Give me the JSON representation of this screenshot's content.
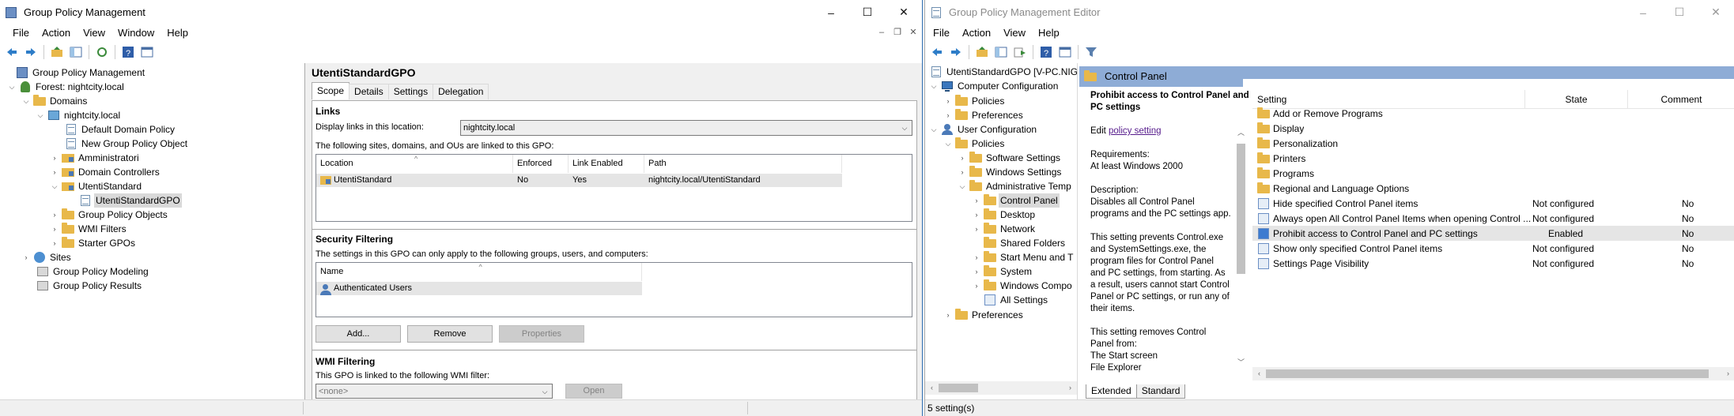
{
  "gpm": {
    "title": "Group Policy Management",
    "menus": [
      "File",
      "Action",
      "View",
      "Window",
      "Help"
    ],
    "window_controls": [
      "–",
      "☐",
      "✕"
    ],
    "mdi_controls": [
      "–",
      "❐",
      "✕"
    ],
    "tree": [
      {
        "label": "Group Policy Management",
        "icon": "gpm-icon"
      },
      {
        "label": "Forest: nightcity.local",
        "icon": "forest-icon"
      },
      {
        "label": "Domains",
        "icon": "folder-icon"
      },
      {
        "label": "nightcity.local",
        "icon": "domain-icon"
      },
      {
        "label": "Default Domain Policy",
        "icon": "gpo-link-icon"
      },
      {
        "label": "New Group Policy Object",
        "icon": "gpo-link-icon"
      },
      {
        "label": "Amministratori",
        "icon": "ou-icon"
      },
      {
        "label": "Domain Controllers",
        "icon": "ou-icon"
      },
      {
        "label": "UtentiStandard",
        "icon": "ou-icon"
      },
      {
        "label": "UtentiStandardGPO",
        "icon": "gpo-link-icon"
      },
      {
        "label": "Group Policy Objects",
        "icon": "folder-icon"
      },
      {
        "label": "WMI Filters",
        "icon": "folder-icon"
      },
      {
        "label": "Starter GPOs",
        "icon": "folder-icon"
      },
      {
        "label": "Sites",
        "icon": "sites-icon"
      },
      {
        "label": "Group Policy Modeling",
        "icon": "modeling-icon"
      },
      {
        "label": "Group Policy Results",
        "icon": "results-icon"
      }
    ],
    "detail": {
      "title": "UtentiStandardGPO",
      "tabs": [
        "Scope",
        "Details",
        "Settings",
        "Delegation"
      ],
      "links_heading": "Links",
      "display_links_label": "Display links in this location:",
      "display_links_value": "nightcity.local",
      "linked_text": "The following sites, domains, and OUs are linked to this GPO:",
      "links_columns": [
        "Location",
        "Enforced",
        "Link Enabled",
        "Path"
      ],
      "links_rows": [
        {
          "location": "UtentiStandard",
          "enforced": "No",
          "link_enabled": "Yes",
          "path": "nightcity.local/UtentiStandard"
        }
      ],
      "security_heading": "Security Filtering",
      "security_text": "The settings in this GPO can only apply to the following groups, users, and computers:",
      "security_columns": [
        "Name"
      ],
      "security_rows": [
        "Authenticated Users"
      ],
      "buttons": {
        "add": "Add...",
        "remove": "Remove",
        "properties": "Properties"
      },
      "wmi_heading": "WMI Filtering",
      "wmi_text": "This GPO is linked to the following WMI filter:",
      "wmi_value": "<none>",
      "wmi_open": "Open"
    }
  },
  "gpme": {
    "title": "Group Policy Management Editor",
    "menus": [
      "File",
      "Action",
      "View",
      "Help"
    ],
    "window_controls": [
      "–",
      "☐",
      "✕"
    ],
    "tree": [
      {
        "label": "UtentiStandardGPO [V-PC.NIGH",
        "icon": "gpo-icon"
      },
      {
        "label": "Computer Configuration",
        "icon": "computer-icon"
      },
      {
        "label": "Policies",
        "icon": "folder-icon"
      },
      {
        "label": "Preferences",
        "icon": "folder-icon"
      },
      {
        "label": "User Configuration",
        "icon": "user-icon"
      },
      {
        "label": "Policies",
        "icon": "folder-icon"
      },
      {
        "label": "Software Settings",
        "icon": "folder-icon"
      },
      {
        "label": "Windows Settings",
        "icon": "folder-icon"
      },
      {
        "label": "Administrative Temp",
        "icon": "folder-icon"
      },
      {
        "label": "Control Panel",
        "icon": "folder-icon"
      },
      {
        "label": "Desktop",
        "icon": "folder-icon"
      },
      {
        "label": "Network",
        "icon": "folder-icon"
      },
      {
        "label": "Shared Folders",
        "icon": "folder-icon"
      },
      {
        "label": "Start Menu and T",
        "icon": "folder-icon"
      },
      {
        "label": "System",
        "icon": "folder-icon"
      },
      {
        "label": "Windows Compo",
        "icon": "folder-icon"
      },
      {
        "label": "All Settings",
        "icon": "all-settings-icon"
      },
      {
        "label": "Preferences",
        "icon": "folder-icon"
      }
    ],
    "header": "Control Panel",
    "description": {
      "title_line1": "Prohibit access to Control Panel and",
      "title_line2": "PC settings",
      "edit_prefix": "Edit ",
      "edit_link": "policy setting",
      "requirements_label": "Requirements:",
      "requirements_value": "At least Windows 2000",
      "description_label": "Description:",
      "lines": [
        "Disables all Control Panel",
        "programs and the PC settings app.",
        "",
        "This setting prevents Control.exe",
        "and SystemSettings.exe, the",
        "program files for Control Panel",
        "and PC settings, from starting. As",
        "a result, users cannot start Control",
        "Panel or PC settings, or run any of",
        "their items.",
        "",
        "This setting removes Control",
        "Panel from:",
        "The Start screen",
        "File Explorer"
      ]
    },
    "columns": [
      "Setting",
      "State",
      "Comment"
    ],
    "rows": [
      {
        "setting": "Add or Remove Programs",
        "state": "",
        "comment": "",
        "icon": "folder-icon"
      },
      {
        "setting": "Display",
        "state": "",
        "comment": "",
        "icon": "folder-icon"
      },
      {
        "setting": "Personalization",
        "state": "",
        "comment": "",
        "icon": "folder-icon"
      },
      {
        "setting": "Printers",
        "state": "",
        "comment": "",
        "icon": "folder-icon"
      },
      {
        "setting": "Programs",
        "state": "",
        "comment": "",
        "icon": "folder-icon"
      },
      {
        "setting": "Regional and Language Options",
        "state": "",
        "comment": "",
        "icon": "folder-icon"
      },
      {
        "setting": "Hide specified Control Panel items",
        "state": "Not configured",
        "comment": "No",
        "icon": "policy-icon"
      },
      {
        "setting": "Always open All Control Panel Items when opening Control ...",
        "state": "Not configured",
        "comment": "No",
        "icon": "policy-icon"
      },
      {
        "setting": "Prohibit access to Control Panel and PC settings",
        "state": "Enabled",
        "comment": "No",
        "icon": "policy-enabled-icon"
      },
      {
        "setting": "Show only specified Control Panel items",
        "state": "Not configured",
        "comment": "No",
        "icon": "policy-icon"
      },
      {
        "setting": "Settings Page Visibility",
        "state": "Not configured",
        "comment": "No",
        "icon": "policy-icon"
      }
    ],
    "bottom_tabs": [
      "Extended",
      "Standard"
    ],
    "status": "5 setting(s)"
  }
}
